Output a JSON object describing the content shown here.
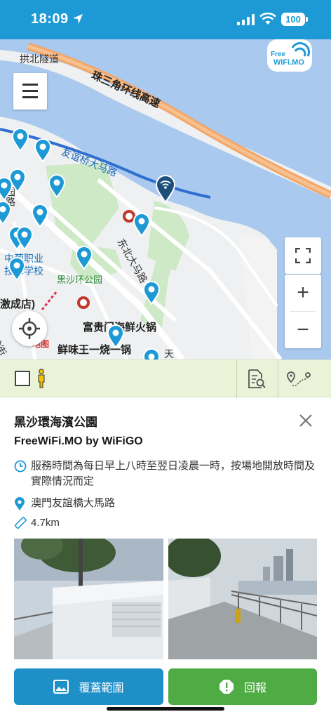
{
  "status_bar": {
    "time": "18:09",
    "battery": "100"
  },
  "logo": {
    "line1": "Free",
    "line2": "WiFi.MO"
  },
  "map": {
    "labels": {
      "tunnel": "拱北隧道",
      "highway": "珠三角环线高速",
      "bridge_road": "友谊桥大马路",
      "garden_road": "园路",
      "school": "中葡职业",
      "school2": "技术学校",
      "park": "黑沙环公园",
      "avenue": "东北大马路",
      "store": "激成店)",
      "restaurant1": "富贵门海鲜火锅",
      "restaurant2": "鲜味王一烧一锅",
      "street": "天",
      "street2": "馀街",
      "baidu": "地图"
    }
  },
  "map_controls": {
    "fullscreen": "⛶",
    "zoom_in": "+",
    "zoom_out": "−"
  },
  "filter_bar": {
    "checkbox_checked": false
  },
  "detail": {
    "title": "黑沙環海濱公園",
    "provider": "FreeWiFi.MO by WiFiGO",
    "hours": "服務時間為每日早上八時至翌日凌晨一時，按場地開放時間及實際情況而定",
    "address": "澳門友誼橋大馬路",
    "distance": "4.7km"
  },
  "buttons": {
    "coverage": "覆蓋範圍",
    "report": "回報"
  },
  "colors": {
    "brand_blue": "#1d9ad6",
    "coverage_btn": "#1f8fc8",
    "report_btn": "#4fab43",
    "filter_bar": "#eaf2d8"
  }
}
